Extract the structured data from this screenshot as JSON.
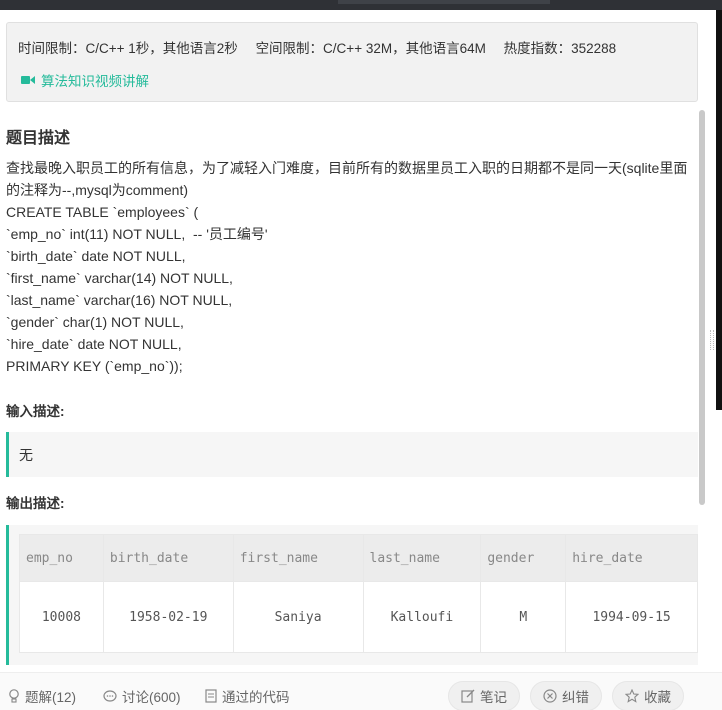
{
  "limits": {
    "time": "时间限制：C/C++ 1秒，其他语言2秒",
    "space": "空间限制：C/C++ 32M，其他语言64M",
    "heat": "热度指数：352288"
  },
  "video_link": "算法知识视频讲解",
  "problem": {
    "title": "题目描述",
    "intro": "查找最晚入职员工的所有信息，为了减轻入门难度，目前所有的数据里员工入职的日期都不是同一天(sqlite里面的注释为--,mysql为comment)",
    "sql_lines": [
      "CREATE TABLE `employees` (",
      "`emp_no` int(11) NOT NULL,  -- '员工编号'",
      "`birth_date` date NOT NULL,",
      "`first_name` varchar(14) NOT NULL,",
      "`last_name` varchar(16) NOT NULL,",
      "`gender` char(1) NOT NULL,",
      "`hire_date` date NOT NULL,",
      "PRIMARY KEY (`emp_no`));"
    ]
  },
  "input": {
    "label": "输入描述:",
    "value": "无"
  },
  "output": {
    "label": "输出描述:",
    "columns": [
      "emp_no",
      "birth_date",
      "first_name",
      "last_name",
      "gender",
      "hire_date"
    ],
    "row": [
      "10008",
      "1958-02-19",
      "Saniya",
      "Kalloufi",
      "M",
      "1994-09-15"
    ]
  },
  "footer": {
    "solutions": "题解(12)",
    "discussion": "讨论(600)",
    "passed_code": "通过的代码",
    "notes": "笔记",
    "report": "纠错",
    "favorite": "收藏"
  },
  "colors": {
    "accent": "#25bb9b",
    "topbar": "#2f3136"
  }
}
